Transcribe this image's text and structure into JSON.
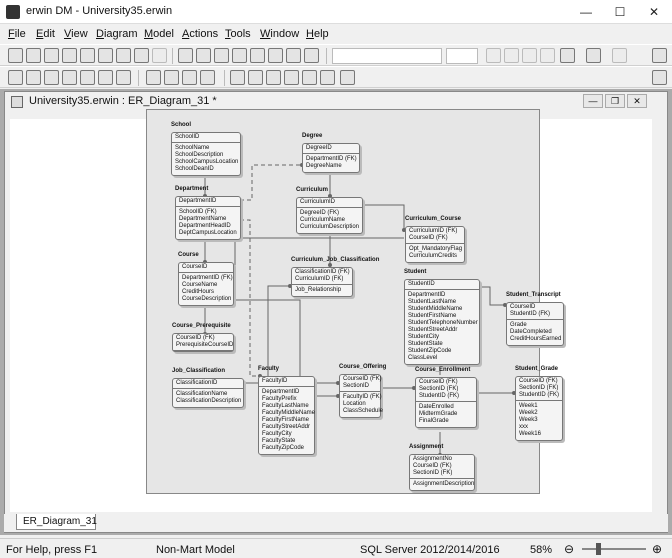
{
  "titlebar": {
    "title": "erwin DM - University35.erwin"
  },
  "menu": [
    "File",
    "Edit",
    "View",
    "Diagram",
    "Model",
    "Actions",
    "Tools",
    "Window",
    "Help"
  ],
  "document": {
    "title": "University35.erwin : ER_Diagram_31 *",
    "tab": "ER_Diagram_31"
  },
  "status": {
    "help": "For Help, press F1",
    "model": "Non-Mart Model",
    "db": "SQL Server 2012/2014/2016",
    "zoom": "58%"
  },
  "entities": {
    "school": {
      "name": "School",
      "pk": [
        "SchoolID"
      ],
      "attrs": [
        "SchoolName",
        "SchoolDescription",
        "SchoolCampusLocation",
        "SchoolDeanID"
      ]
    },
    "degree": {
      "name": "Degree",
      "pk": [
        "DegreeID"
      ],
      "attrs": [
        "DepartmentID (FK)",
        "DegreeName"
      ]
    },
    "department": {
      "name": "Department",
      "pk": [
        "DepartmentID"
      ],
      "attrs": [
        "SchoolID (FK)",
        "DepartmentName",
        "DepartmentHeadID",
        "DeptCampusLocation"
      ]
    },
    "curriculum": {
      "name": "Curriculum",
      "pk": [
        "CurriculumID"
      ],
      "attrs": [
        "DegreeID (FK)",
        "CurriculumName",
        "CurriculumDescription"
      ]
    },
    "curriculum_course": {
      "name": "Curriculum_Course",
      "pk": [
        "CurriculumID (FK)",
        "CourseID (FK)"
      ],
      "attrs": [
        "Opt_MandatoryFlag",
        "CurriculumCredits"
      ]
    },
    "course": {
      "name": "Course",
      "pk": [
        "CourseID"
      ],
      "attrs": [
        "DepartmentID (FK)",
        "CourseName",
        "CreditHours",
        "CourseDescription"
      ]
    },
    "curr_job": {
      "name": "Curriculum_Job_Classification",
      "pk": [
        "ClassificationID (FK)",
        "CurriculumID (FK)"
      ],
      "attrs": [
        "Job_Relationship"
      ]
    },
    "student": {
      "name": "Student",
      "pk": [
        "StudentID"
      ],
      "attrs": [
        "DepartmentID",
        "StudentLastName",
        "StudentMiddleName",
        "StudentFirstName",
        "StudentTelephoneNumber",
        "StudentStreetAddr",
        "StudentCity",
        "StudentState",
        "StudentZipCode",
        "ClassLevel"
      ]
    },
    "transcript": {
      "name": "Student_Transcript",
      "pk": [
        "CourseID",
        "StudentID (FK)"
      ],
      "attrs": [
        "Grade",
        "DateCompleted",
        "CreditHoursEarned"
      ]
    },
    "prereq": {
      "name": "Course_Prerequisite",
      "pk": [
        "CourseID (FK)",
        "PrerequisiteCourseID"
      ],
      "attrs": []
    },
    "jobclass": {
      "name": "Job_Classification",
      "pk": [
        "ClassificationID"
      ],
      "attrs": [
        "ClassificationName",
        "ClassificationDescription"
      ]
    },
    "faculty": {
      "name": "Faculty",
      "pk": [
        "FacultyID"
      ],
      "attrs": [
        "DepartmentID",
        "FacultyPrefix",
        "FacultyLastName",
        "FacultyMiddleName",
        "FacultyFirstName",
        "FacultyStreetAddr",
        "FacultyCity",
        "FacultyState",
        "FacultyZipCode"
      ]
    },
    "offering": {
      "name": "Course_Offering",
      "pk": [
        "CourseID (FK)",
        "SectionID"
      ],
      "attrs": [
        "FacultyID (FK)",
        "Location",
        "ClassSchedule"
      ]
    },
    "enrollment": {
      "name": "Course_Enrollment",
      "pk": [
        "CourseID (FK)",
        "SectionID (FK)",
        "StudentID (FK)"
      ],
      "attrs": [
        "DateEnrolled",
        "MidtermGrade",
        "FinalGrade"
      ]
    },
    "grade": {
      "name": "Student_Grade",
      "pk": [
        "CourseID (FK)",
        "SectionID (FK)",
        "StudentID (FK)"
      ],
      "attrs": [
        "Week1",
        "Week2",
        "Week3",
        "xxx",
        "Week16"
      ]
    },
    "assignment": {
      "name": "Assignment",
      "pk": [
        "AssignmentNo",
        "CourseID (FK)",
        "SectionID (FK)"
      ],
      "attrs": [
        "AssignmentDescription"
      ]
    }
  }
}
